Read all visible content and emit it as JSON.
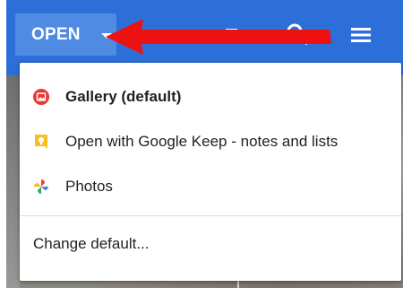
{
  "toolbar": {
    "open_label": "OPEN",
    "icons": [
      "edit-icon",
      "stop-icon",
      "search-icon",
      "menu-icon"
    ]
  },
  "dropdown": {
    "items": [
      {
        "label": "Gallery (default)",
        "icon": "gallery-app-icon",
        "color": "#e53935"
      },
      {
        "label": "Open with Google Keep - notes and lists",
        "icon": "google-keep-icon",
        "color": "#f6bf26"
      },
      {
        "label": "Photos",
        "icon": "google-photos-icon"
      }
    ],
    "change_default_label": "Change default..."
  },
  "colors": {
    "toolbar_bg": "#2d6fd8",
    "open_button_bg": "#4f8ae3",
    "annotation_arrow": "#ee1111"
  }
}
